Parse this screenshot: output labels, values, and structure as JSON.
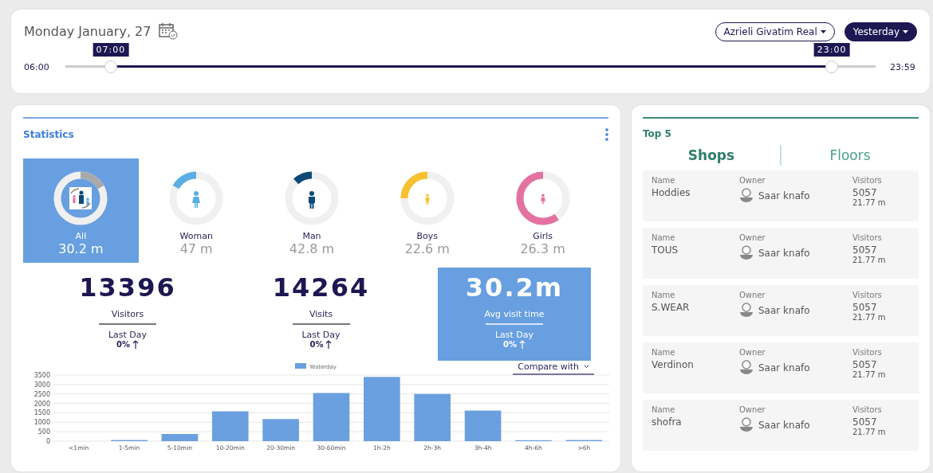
{
  "header": {
    "date": "Monday January, 27",
    "location_button": "Azrieli Givatim Real",
    "period_button": "Yesterday"
  },
  "time_slider": {
    "min_label": "06:00",
    "max_label": "23:59",
    "handles": [
      {
        "label": "07:00",
        "level": 0.056
      },
      {
        "label": "23:00",
        "level": 0.946
      }
    ]
  },
  "statistics": {
    "title": "Statistics",
    "segments": [
      {
        "kind": "group",
        "label": "All",
        "value": "30.2 m",
        "level": 0.17,
        "color": "#a9a9a9",
        "selected": true
      },
      {
        "kind": "woman",
        "label": "Woman",
        "value": "47 m",
        "level": 0.17,
        "color": "#5aaee3",
        "selected": false
      },
      {
        "kind": "man",
        "label": "Man",
        "value": "42.8 m",
        "level": 0.12,
        "color": "#0e4a78",
        "selected": false
      },
      {
        "kind": "boy",
        "label": "Boys",
        "value": "22.6 m",
        "level": 0.25,
        "color": "#f7c132",
        "selected": false
      },
      {
        "kind": "girl",
        "label": "Girls",
        "value": "26.3 m",
        "level": 0.6,
        "color": "#e472a0",
        "selected": false
      }
    ],
    "metrics": [
      {
        "value": "13396",
        "label": "Visitors",
        "compare_label": "Last Day",
        "change": "0%",
        "selected": false
      },
      {
        "value": "14264",
        "label": "Visits",
        "compare_label": "Last Day",
        "change": "0%",
        "selected": false
      },
      {
        "value": "30.2m",
        "label": "Avg visit time",
        "compare_label": "Last Day",
        "change": "0%",
        "selected": true
      }
    ],
    "compare_button": "Compare with",
    "chart_data": {
      "type": "bar",
      "categories": [
        "<1min",
        "1-5min",
        "5-10min",
        "10-20min",
        "20-30min",
        "30-60min",
        "1h-2h",
        "2h-3h",
        "3h-4h",
        "4h-6h",
        ">6h"
      ],
      "series": [
        {
          "name": "Yesterday",
          "color": "#6a9fe0",
          "values": [
            0,
            60,
            380,
            1580,
            1170,
            2550,
            3400,
            2500,
            1620,
            50,
            60
          ]
        }
      ],
      "ylim": [
        0,
        3500
      ],
      "grid": true,
      "yticks": [
        0,
        500,
        1000,
        1500,
        2000,
        2500,
        3000,
        3500
      ]
    }
  },
  "top5": {
    "title": "Top 5",
    "tabs": [
      {
        "label": "Shops",
        "selected": true
      },
      {
        "label": "Floors",
        "selected": false
      }
    ],
    "rows": [
      {
        "name_label": "Name",
        "name": "Hoddies",
        "owner_label": "Owner",
        "owner": "Saar knafo",
        "visitors_label": "Visitors",
        "visitors": "5057",
        "time": "21.77 m"
      },
      {
        "name_label": "Name",
        "name": "TOUS",
        "owner_label": "Owner",
        "owner": "Saar knafo",
        "visitors_label": "Visitors",
        "visitors": "5057",
        "time": "21.77 m"
      },
      {
        "name_label": "Name",
        "name": "S.WEAR",
        "owner_label": "Owner",
        "owner": "Saar knafo",
        "visitors_label": "Visitors",
        "visitors": "5057",
        "time": "21.77 m"
      },
      {
        "name_label": "Name",
        "name": "Verdinon",
        "owner_label": "Owner",
        "owner": "Saar knafo",
        "visitors_label": "Visitors",
        "visitors": "5057",
        "time": "21.77 m"
      },
      {
        "name_label": "Name",
        "name": "shofra",
        "owner_label": "Owner",
        "owner": "Saar knafo",
        "visitors_label": "Visitors",
        "visitors": "5057",
        "time": "21.77 m"
      }
    ]
  }
}
